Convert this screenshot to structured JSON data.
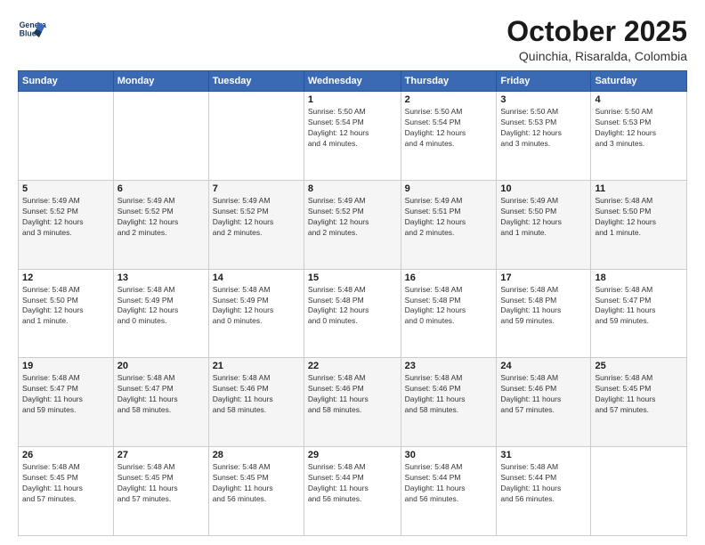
{
  "logo": {
    "line1": "General",
    "line2": "Blue"
  },
  "title": "October 2025",
  "subtitle": "Quinchia, Risaralda, Colombia",
  "weekdays": [
    "Sunday",
    "Monday",
    "Tuesday",
    "Wednesday",
    "Thursday",
    "Friday",
    "Saturday"
  ],
  "weeks": [
    [
      {
        "day": "",
        "info": ""
      },
      {
        "day": "",
        "info": ""
      },
      {
        "day": "",
        "info": ""
      },
      {
        "day": "1",
        "info": "Sunrise: 5:50 AM\nSunset: 5:54 PM\nDaylight: 12 hours\nand 4 minutes."
      },
      {
        "day": "2",
        "info": "Sunrise: 5:50 AM\nSunset: 5:54 PM\nDaylight: 12 hours\nand 4 minutes."
      },
      {
        "day": "3",
        "info": "Sunrise: 5:50 AM\nSunset: 5:53 PM\nDaylight: 12 hours\nand 3 minutes."
      },
      {
        "day": "4",
        "info": "Sunrise: 5:50 AM\nSunset: 5:53 PM\nDaylight: 12 hours\nand 3 minutes."
      }
    ],
    [
      {
        "day": "5",
        "info": "Sunrise: 5:49 AM\nSunset: 5:52 PM\nDaylight: 12 hours\nand 3 minutes."
      },
      {
        "day": "6",
        "info": "Sunrise: 5:49 AM\nSunset: 5:52 PM\nDaylight: 12 hours\nand 2 minutes."
      },
      {
        "day": "7",
        "info": "Sunrise: 5:49 AM\nSunset: 5:52 PM\nDaylight: 12 hours\nand 2 minutes."
      },
      {
        "day": "8",
        "info": "Sunrise: 5:49 AM\nSunset: 5:52 PM\nDaylight: 12 hours\nand 2 minutes."
      },
      {
        "day": "9",
        "info": "Sunrise: 5:49 AM\nSunset: 5:51 PM\nDaylight: 12 hours\nand 2 minutes."
      },
      {
        "day": "10",
        "info": "Sunrise: 5:49 AM\nSunset: 5:50 PM\nDaylight: 12 hours\nand 1 minute."
      },
      {
        "day": "11",
        "info": "Sunrise: 5:48 AM\nSunset: 5:50 PM\nDaylight: 12 hours\nand 1 minute."
      }
    ],
    [
      {
        "day": "12",
        "info": "Sunrise: 5:48 AM\nSunset: 5:50 PM\nDaylight: 12 hours\nand 1 minute."
      },
      {
        "day": "13",
        "info": "Sunrise: 5:48 AM\nSunset: 5:49 PM\nDaylight: 12 hours\nand 0 minutes."
      },
      {
        "day": "14",
        "info": "Sunrise: 5:48 AM\nSunset: 5:49 PM\nDaylight: 12 hours\nand 0 minutes."
      },
      {
        "day": "15",
        "info": "Sunrise: 5:48 AM\nSunset: 5:48 PM\nDaylight: 12 hours\nand 0 minutes."
      },
      {
        "day": "16",
        "info": "Sunrise: 5:48 AM\nSunset: 5:48 PM\nDaylight: 12 hours\nand 0 minutes."
      },
      {
        "day": "17",
        "info": "Sunrise: 5:48 AM\nSunset: 5:48 PM\nDaylight: 11 hours\nand 59 minutes."
      },
      {
        "day": "18",
        "info": "Sunrise: 5:48 AM\nSunset: 5:47 PM\nDaylight: 11 hours\nand 59 minutes."
      }
    ],
    [
      {
        "day": "19",
        "info": "Sunrise: 5:48 AM\nSunset: 5:47 PM\nDaylight: 11 hours\nand 59 minutes."
      },
      {
        "day": "20",
        "info": "Sunrise: 5:48 AM\nSunset: 5:47 PM\nDaylight: 11 hours\nand 58 minutes."
      },
      {
        "day": "21",
        "info": "Sunrise: 5:48 AM\nSunset: 5:46 PM\nDaylight: 11 hours\nand 58 minutes."
      },
      {
        "day": "22",
        "info": "Sunrise: 5:48 AM\nSunset: 5:46 PM\nDaylight: 11 hours\nand 58 minutes."
      },
      {
        "day": "23",
        "info": "Sunrise: 5:48 AM\nSunset: 5:46 PM\nDaylight: 11 hours\nand 58 minutes."
      },
      {
        "day": "24",
        "info": "Sunrise: 5:48 AM\nSunset: 5:46 PM\nDaylight: 11 hours\nand 57 minutes."
      },
      {
        "day": "25",
        "info": "Sunrise: 5:48 AM\nSunset: 5:45 PM\nDaylight: 11 hours\nand 57 minutes."
      }
    ],
    [
      {
        "day": "26",
        "info": "Sunrise: 5:48 AM\nSunset: 5:45 PM\nDaylight: 11 hours\nand 57 minutes."
      },
      {
        "day": "27",
        "info": "Sunrise: 5:48 AM\nSunset: 5:45 PM\nDaylight: 11 hours\nand 57 minutes."
      },
      {
        "day": "28",
        "info": "Sunrise: 5:48 AM\nSunset: 5:45 PM\nDaylight: 11 hours\nand 56 minutes."
      },
      {
        "day": "29",
        "info": "Sunrise: 5:48 AM\nSunset: 5:44 PM\nDaylight: 11 hours\nand 56 minutes."
      },
      {
        "day": "30",
        "info": "Sunrise: 5:48 AM\nSunset: 5:44 PM\nDaylight: 11 hours\nand 56 minutes."
      },
      {
        "day": "31",
        "info": "Sunrise: 5:48 AM\nSunset: 5:44 PM\nDaylight: 11 hours\nand 56 minutes."
      },
      {
        "day": "",
        "info": ""
      }
    ]
  ]
}
